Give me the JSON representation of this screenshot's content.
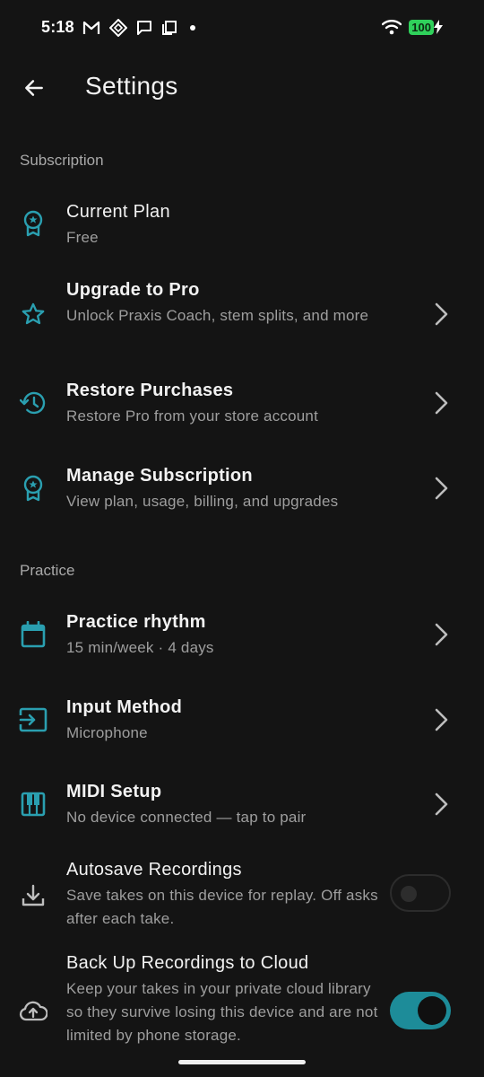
{
  "status_bar": {
    "time": "5:18",
    "battery": "100"
  },
  "header": {
    "title": "Settings"
  },
  "sections": {
    "subscription": "Subscription",
    "practice": "Practice"
  },
  "rows": {
    "current_plan": {
      "title": "Current Plan",
      "subtitle": "Free",
      "icon": "award-badge-icon"
    },
    "upgrade": {
      "title": "Upgrade to Pro",
      "subtitle": "Unlock Praxis Coach, stem splits, and more",
      "icon": "star-outline-icon"
    },
    "restore": {
      "title": "Restore Purchases",
      "subtitle": "Restore Pro from your store account",
      "icon": "history-icon"
    },
    "manage": {
      "title": "Manage Subscription",
      "subtitle": "View plan, usage, billing, and upgrades",
      "icon": "award-badge-icon"
    },
    "rhythm": {
      "title": "Practice rhythm",
      "subtitle": "15 min/week · 4 days",
      "icon": "calendar-icon"
    },
    "input": {
      "title": "Input Method",
      "subtitle": "Microphone",
      "icon": "input-icon"
    },
    "midi": {
      "title": "MIDI Setup",
      "subtitle": "No device connected — tap to pair",
      "icon": "piano-icon"
    },
    "autosave": {
      "title": "Autosave Recordings",
      "subtitle": "Save takes on this device for replay. Off asks after each take.",
      "icon": "download-icon",
      "enabled": false
    },
    "backup": {
      "title": "Back Up Recordings to Cloud",
      "subtitle": "Keep your takes in your private cloud library so they survive losing this device and are not limited by phone storage.",
      "icon": "cloud-upload-icon",
      "enabled": true
    }
  },
  "colors": {
    "background": "#141414",
    "accent": "#1d8c99",
    "icon_teal": "#2a9fb0",
    "text_primary": "#f2f2f2",
    "text_secondary": "#9e9e9e"
  }
}
